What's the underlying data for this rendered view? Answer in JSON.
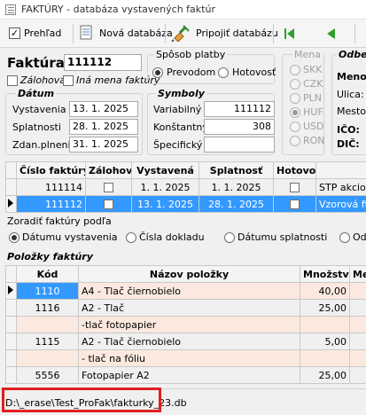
{
  "window": {
    "title": "FAKTÚRY - databáza vystavených faktúr"
  },
  "toolbar": {
    "prehlad_label": "Prehľad",
    "prehlad_checked": true,
    "new_db_label": "Nová databáza",
    "connect_db_label": "Pripojiť databázu"
  },
  "invoice": {
    "label": "Faktúra:",
    "number": "111112",
    "zalohova_label": "Zálohová",
    "ina_mena_label": "Iná mena faktúry"
  },
  "datum": {
    "header": "Dátum",
    "vystavenia_label": "Vystavenia",
    "vystavenia_value": "13. 1. 2025",
    "splatnosti_label": "Splatnosti",
    "splatnosti_value": "28. 1. 2025",
    "zdan_label": "Zdan.plnenia",
    "zdan_value": "31. 1. 2025"
  },
  "payment": {
    "header": "Spôsob platby",
    "prevodom_label": "Prevodom",
    "hotovost_label": "Hotovosť",
    "selected": "Prevodom"
  },
  "symboly": {
    "header": "Symboly",
    "variabilny_label": "Variabilný",
    "variabilny_value": "111112",
    "konstantny_label": "Konštantný",
    "konstantny_value": "308",
    "specificky_label": "Špecifický",
    "specificky_value": ""
  },
  "mena": {
    "header": "Mena",
    "options": [
      "SKK",
      "CZK",
      "PLN",
      "HUF",
      "USD",
      "RON"
    ],
    "selected": "HUF"
  },
  "odberatel": {
    "header": "Odber",
    "meno_label": "Meno:",
    "ulica_label": "Ulica:",
    "mesto_label": "Mesto:",
    "ico_label": "IČO:",
    "dic_label": "DIČ:"
  },
  "invoices_table": {
    "columns": [
      "Číslo faktúry",
      "Zálohová",
      "Vystavená",
      "Splatnosť",
      "Hotovosť",
      ""
    ],
    "rows": [
      {
        "cislo": "111114",
        "vystavena": "1. 1. 2025",
        "splatnost": "1. 1. 2025",
        "nazov": "STP akciová s"
      },
      {
        "cislo": "111112",
        "vystavena": "13. 1. 2025",
        "splatnost": "28. 1. 2025",
        "nazov": "Vzorová firma"
      }
    ]
  },
  "sort": {
    "label": "Zoradiť faktúry podľa",
    "options": [
      "Dátumu vystavenia",
      "Čísla dokladu",
      "Dátumu splatnosti",
      "Odb"
    ],
    "selected": "Dátumu vystavenia"
  },
  "items": {
    "header": "Položky faktúry",
    "columns": [
      "Kód",
      "Názov položky",
      "Množstvo",
      "Mer"
    ],
    "rows": [
      {
        "kod": "1110",
        "nazov": "A4 - Tlač čiernobielo",
        "mnozstvo": "40,00"
      },
      {
        "kod": "1116",
        "nazov": "A2 - Tlač",
        "mnozstvo": "25,00"
      },
      {
        "kod": "",
        "nazov": "-tlač fotopapier",
        "mnozstvo": ""
      },
      {
        "kod": "1115",
        "nazov": "A2 - Tlač čiernobielo",
        "mnozstvo": "5,00"
      },
      {
        "kod": "",
        "nazov": "- tlač na fóliu",
        "mnozstvo": ""
      },
      {
        "kod": "5556",
        "nazov": "Fotopapier A2",
        "mnozstvo": "25,00"
      }
    ]
  },
  "status": {
    "path": "D:\\_erase\\Test_ProFak\\fakturky_23.db"
  },
  "colors": {
    "accent": "#3399ff",
    "highlight": "#e02020",
    "row_pink": "#fbe9df"
  }
}
